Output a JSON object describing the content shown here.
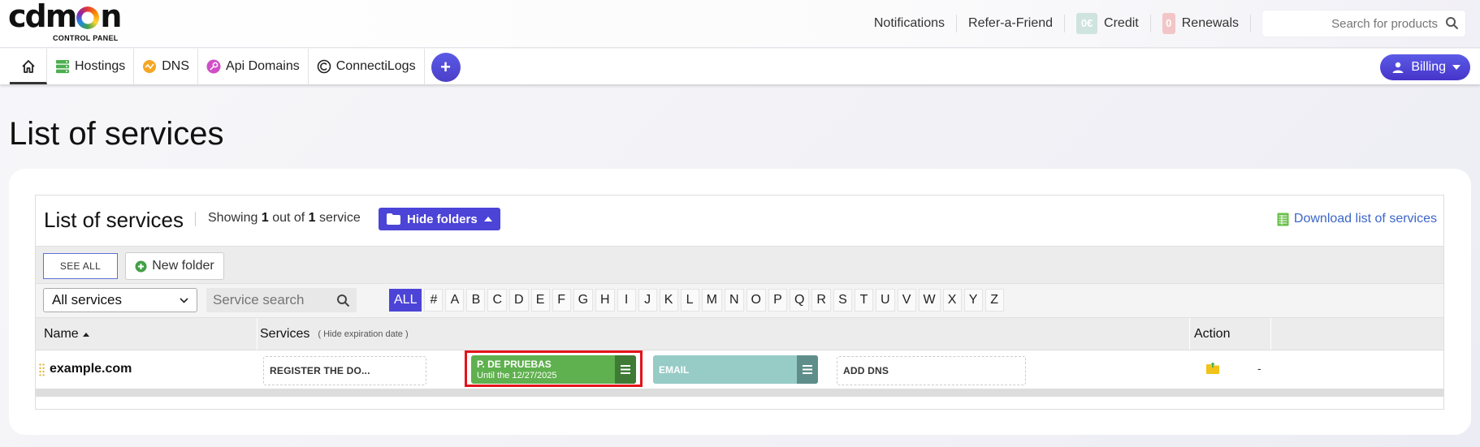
{
  "header": {
    "logo_text": "cdmon",
    "logo_subtitle": "CONTROL PANEL",
    "links": {
      "notifications": "Notifications",
      "refer": "Refer-a-Friend",
      "credit_badge": "0€",
      "credit": "Credit",
      "renewals_badge": "0",
      "renewals": "Renewals"
    },
    "search_placeholder": "Search for products"
  },
  "navbar": {
    "tabs": {
      "hostings": "Hostings",
      "dns": "DNS",
      "api_domains": "Api Domains",
      "connectilogs": "ConnectiLogs"
    },
    "add": "+",
    "billing": "Billing"
  },
  "page": {
    "title": "List of services"
  },
  "list": {
    "title": "List of services",
    "count_prefix": "Showing",
    "count_shown": "1",
    "count_mid": "out of",
    "count_total": "1",
    "count_suffix": "service",
    "hide_folders": "Hide folders",
    "download": "Download list of services",
    "see_all": "SEE ALL",
    "new_folder": "New folder",
    "filter_value": "All services",
    "search_placeholder": "Service search",
    "letters": [
      "ALL",
      "#",
      "A",
      "B",
      "C",
      "D",
      "E",
      "F",
      "G",
      "H",
      "I",
      "J",
      "K",
      "L",
      "M",
      "N",
      "O",
      "P",
      "Q",
      "R",
      "S",
      "T",
      "U",
      "V",
      "W",
      "X",
      "Y",
      "Z"
    ]
  },
  "table": {
    "col_name": "Name",
    "col_services": "Services",
    "hide_expiration": "( Hide expiration date )",
    "col_action": "Action",
    "row": {
      "domain": "example.com",
      "register": "REGISTER THE DO...",
      "hosting_name": "P. DE PRUEBAS",
      "hosting_until": "Until the 12/27/2025",
      "email": "EMAIL",
      "add_dns": "ADD DNS",
      "action_dash": "-"
    }
  },
  "colors": {
    "accent": "#4c44d6",
    "service_green": "#5fb04e",
    "service_teal": "#96cbc6",
    "highlight": "#e3141b",
    "link": "#3b66c9"
  }
}
